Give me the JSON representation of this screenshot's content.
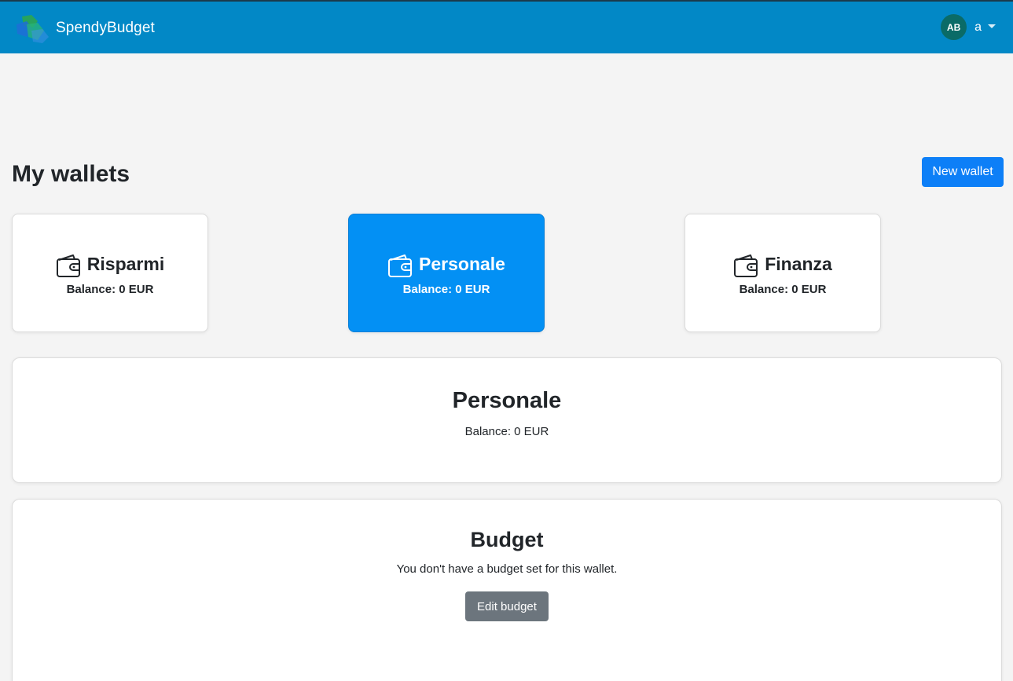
{
  "app": {
    "brand_name": "SpendyBudget",
    "logo_icon": "spendybudget-logo-icon",
    "colors": {
      "navbar": "#0288c6",
      "primary": "#0d7ff7",
      "active_card": "#0390f4",
      "secondary": "#6c757d",
      "avatar": "#0a6b67"
    }
  },
  "user": {
    "initials": "AB",
    "name": "a"
  },
  "page": {
    "title": "My wallets",
    "new_wallet_label": "New wallet"
  },
  "wallets": [
    {
      "name": "Risparmi",
      "balance": "Balance: 0 EUR",
      "icon": "wallet-icon",
      "active": false
    },
    {
      "name": "Personale",
      "balance": "Balance: 0 EUR",
      "icon": "wallet-icon",
      "active": true
    },
    {
      "name": "Finanza",
      "balance": "Balance: 0 EUR",
      "icon": "wallet-icon",
      "active": false
    }
  ],
  "selected_wallet": {
    "name": "Personale",
    "balance": "Balance: 0 EUR"
  },
  "budget": {
    "title": "Budget",
    "message": "You don't have a budget set for this wallet.",
    "edit_label": "Edit budget"
  }
}
